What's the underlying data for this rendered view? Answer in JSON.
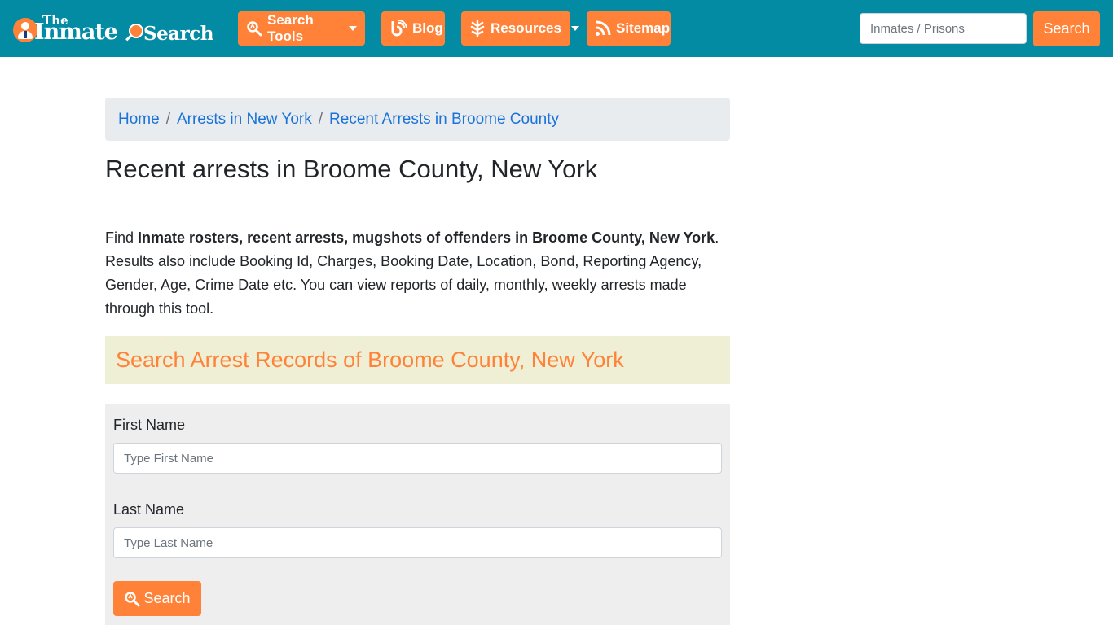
{
  "navbar": {
    "logo": {
      "the": "The",
      "inmate": "Inmate",
      "search": "Search"
    },
    "items": [
      {
        "label": "Search Tools",
        "icon": "search-icon",
        "dropdown": true
      },
      {
        "label": "Blog",
        "icon": "blog-icon",
        "dropdown": false
      },
      {
        "label": "Resources",
        "icon": "leaf-icon",
        "dropdown": true
      },
      {
        "label": "Sitemap",
        "icon": "rss-icon",
        "dropdown": false
      }
    ],
    "search": {
      "placeholder": "Inmates / Prisons",
      "value": "",
      "button_label": "Search"
    }
  },
  "colors": {
    "navbar": "#028ba3",
    "accent": "#ff8238",
    "link": "#1a73d9",
    "section_bg": "#efefd5",
    "panel_bg": "#eeeeee"
  },
  "breadcrumb": [
    {
      "label": "Home"
    },
    {
      "label": "Arrests in New York"
    },
    {
      "label": "Recent Arrests in Broome County"
    }
  ],
  "page_title": "Recent arrests in Broome County, New York",
  "intro": {
    "prefix": "Find ",
    "bold": "Inmate rosters, recent arrests, mugshots of offenders in Broome County, New York",
    "suffix": ". Results also include Booking Id, Charges, Booking Date, Location, Bond, Reporting Agency, Gender, Age, Crime Date etc. You can view reports of daily, monthly, weekly arrests made through this tool."
  },
  "section_heading": "Search Arrest Records of Broome County, New York",
  "form": {
    "first_name": {
      "label": "First Name",
      "placeholder": "Type First Name",
      "value": ""
    },
    "last_name": {
      "label": "Last Name",
      "placeholder": "Type Last Name",
      "value": ""
    },
    "search_button": "Search"
  }
}
